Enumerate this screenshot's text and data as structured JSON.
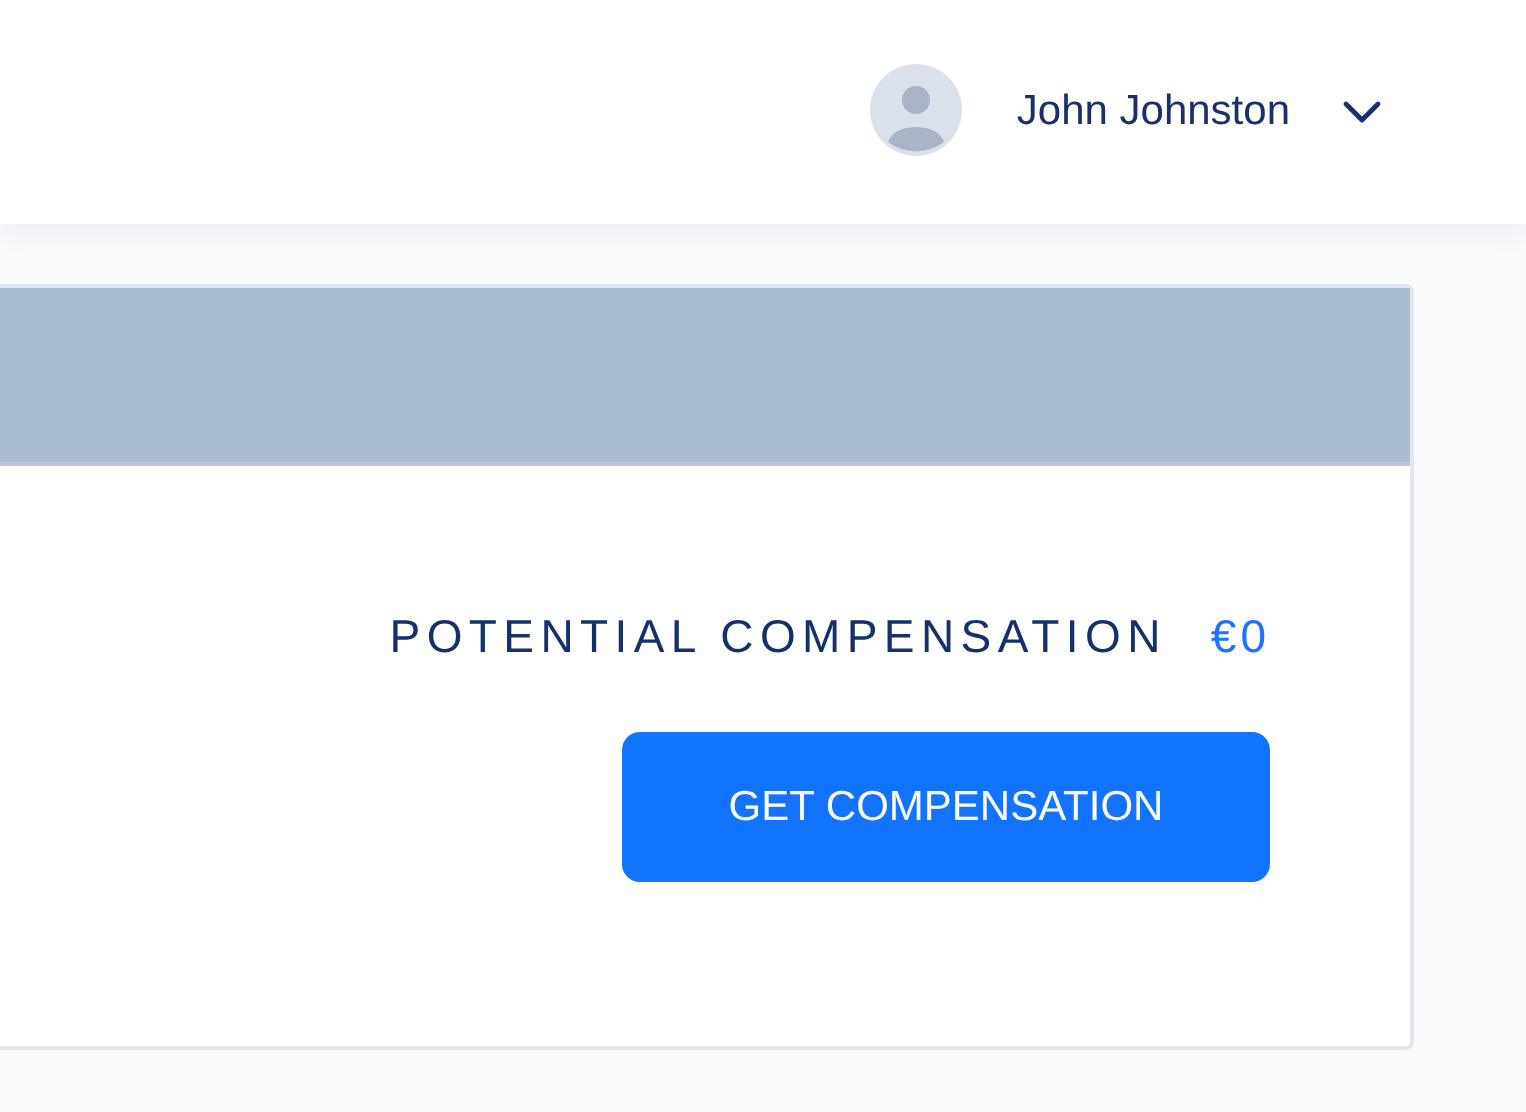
{
  "header": {
    "user": {
      "name": "John Johnston"
    }
  },
  "card": {
    "summary": {
      "label": "POTENTIAL COMPENSATION",
      "amount": "€0"
    },
    "action": {
      "label": "GET COMPENSATION"
    }
  }
}
